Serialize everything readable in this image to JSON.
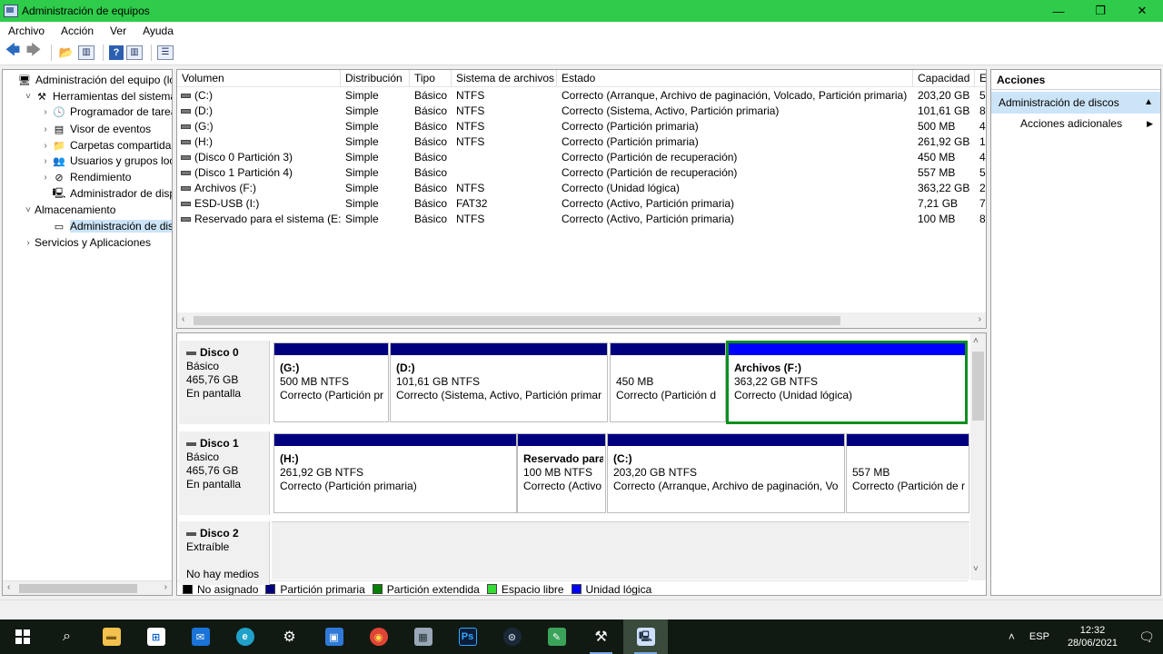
{
  "window": {
    "title": "Administración de equipos"
  },
  "menu": [
    "Archivo",
    "Acción",
    "Ver",
    "Ayuda"
  ],
  "tree": {
    "items": [
      {
        "label": "Administración del equipo (loc",
        "depth": 0,
        "expander": "",
        "icon": "computer-management-icon",
        "glyph": "🖥"
      },
      {
        "label": "Herramientas del sistema",
        "depth": 1,
        "expander": "˅",
        "icon": "tools-icon",
        "glyph": "⚒"
      },
      {
        "label": "Programador de tareas",
        "depth": 2,
        "expander": "›",
        "icon": "clock-icon",
        "glyph": "🕓"
      },
      {
        "label": "Visor de eventos",
        "depth": 2,
        "expander": "›",
        "icon": "event-viewer-icon",
        "glyph": "▤"
      },
      {
        "label": "Carpetas compartidas",
        "depth": 2,
        "expander": "›",
        "icon": "shared-folder-icon",
        "glyph": "📁"
      },
      {
        "label": "Usuarios y grupos locale",
        "depth": 2,
        "expander": "›",
        "icon": "users-icon",
        "glyph": "👥"
      },
      {
        "label": "Rendimiento",
        "depth": 2,
        "expander": "›",
        "icon": "performance-icon",
        "glyph": "⊘"
      },
      {
        "label": "Administrador de dispo",
        "depth": 2,
        "expander": "",
        "icon": "device-manager-icon",
        "glyph": "🖳"
      },
      {
        "label": "Almacenamiento",
        "depth": 1,
        "expander": "˅",
        "icon": "storage-icon",
        "glyph": ""
      },
      {
        "label": "Administración de disco",
        "depth": 2,
        "expander": "",
        "icon": "disk-management-icon",
        "glyph": "▭"
      },
      {
        "label": "Servicios y Aplicaciones",
        "depth": 1,
        "expander": "›",
        "icon": "services-icon",
        "glyph": ""
      }
    ],
    "selected_index": 9
  },
  "volumes": {
    "columns": [
      "Volumen",
      "Distribución",
      "Tipo",
      "Sistema de archivos",
      "Estado",
      "Capacidad",
      "E"
    ],
    "rows": [
      [
        "(C:)",
        "Simple",
        "Básico",
        "NTFS",
        "Correcto (Arranque, Archivo de paginación, Volcado, Partición primaria)",
        "203,20 GB",
        "5"
      ],
      [
        "(D:)",
        "Simple",
        "Básico",
        "NTFS",
        "Correcto (Sistema, Activo, Partición primaria)",
        "101,61 GB",
        "8"
      ],
      [
        "(G:)",
        "Simple",
        "Básico",
        "NTFS",
        "Correcto (Partición primaria)",
        "500 MB",
        "4"
      ],
      [
        "(H:)",
        "Simple",
        "Básico",
        "NTFS",
        "Correcto (Partición primaria)",
        "261,92 GB",
        "1"
      ],
      [
        "(Disco 0 Partición 3)",
        "Simple",
        "Básico",
        "",
        "Correcto (Partición de recuperación)",
        "450 MB",
        "4"
      ],
      [
        "(Disco 1 Partición 4)",
        "Simple",
        "Básico",
        "",
        "Correcto (Partición de recuperación)",
        "557 MB",
        "5"
      ],
      [
        "Archivos (F:)",
        "Simple",
        "Básico",
        "NTFS",
        "Correcto (Unidad lógica)",
        "363,22 GB",
        "2"
      ],
      [
        "ESD-USB (I:)",
        "Simple",
        "Básico",
        "FAT32",
        "Correcto (Activo, Partición primaria)",
        "7,21 GB",
        "7,"
      ],
      [
        "Reservado para el sistema (E:)",
        "Simple",
        "Básico",
        "NTFS",
        "Correcto (Activo, Partición primaria)",
        "100 MB",
        "8"
      ]
    ]
  },
  "disks": [
    {
      "name": "Disco 0",
      "type": "Básico",
      "size": "465,76 GB",
      "state": "En pantalla",
      "partitions": [
        {
          "name": "(G:)",
          "size": "500 MB NTFS",
          "status": "Correcto (Partición pr",
          "kind": "primary",
          "selected": false
        },
        {
          "name": "(D:)",
          "size": "101,61 GB NTFS",
          "status": "Correcto (Sistema, Activo, Partición primar",
          "kind": "primary",
          "selected": false
        },
        {
          "name": "",
          "size": "450 MB",
          "status": "Correcto (Partición d",
          "kind": "primary",
          "selected": false
        },
        {
          "name": "Archivos  (F:)",
          "size": "363,22 GB NTFS",
          "status": "Correcto (Unidad lógica)",
          "kind": "logical",
          "selected": true
        }
      ]
    },
    {
      "name": "Disco 1",
      "type": "Básico",
      "size": "465,76 GB",
      "state": "En pantalla",
      "partitions": [
        {
          "name": "(H:)",
          "size": "261,92 GB NTFS",
          "status": "Correcto (Partición primaria)",
          "kind": "primary",
          "selected": false
        },
        {
          "name": "Reservado para",
          "size": "100 MB NTFS",
          "status": "Correcto (Activo",
          "kind": "primary",
          "selected": false
        },
        {
          "name": "(C:)",
          "size": "203,20 GB NTFS",
          "status": "Correcto (Arranque, Archivo de paginación, Vo",
          "kind": "primary",
          "selected": false
        },
        {
          "name": "",
          "size": "557 MB",
          "status": "Correcto (Partición de r",
          "kind": "primary",
          "selected": false
        }
      ]
    },
    {
      "name": "Disco 2",
      "type": "Extraíble",
      "size": "",
      "state": "No hay medios",
      "partitions": []
    }
  ],
  "legend": [
    {
      "label": "No asignado",
      "color": "#000000"
    },
    {
      "label": "Partición primaria",
      "color": "#00007f"
    },
    {
      "label": "Partición extendida",
      "color": "#008000"
    },
    {
      "label": "Espacio libre",
      "color": "#33dd33"
    },
    {
      "label": "Unidad lógica",
      "color": "#0000ff"
    }
  ],
  "actions": {
    "header": "Acciones",
    "section": "Administración de discos",
    "item": "Acciones adicionales"
  },
  "taskbar": {
    "apps": [
      "start-icon",
      "search-icon",
      "file-explorer-icon",
      "store-icon",
      "mail-icon",
      "edge-icon",
      "settings-icon",
      "outlook-icon",
      "chrome-icon",
      "network-icon",
      "photoshop-icon",
      "steam-icon",
      "greenshot-icon",
      "tools-icon",
      "computer-management-icon"
    ],
    "ps_label": "Ps",
    "lang": "ESP",
    "time": "12:32",
    "date": "28/06/2021"
  },
  "colors": {
    "titlebar": "#2ecc4a",
    "selection": "#cce4f7",
    "selected_partition_border": "#0a8f20"
  }
}
